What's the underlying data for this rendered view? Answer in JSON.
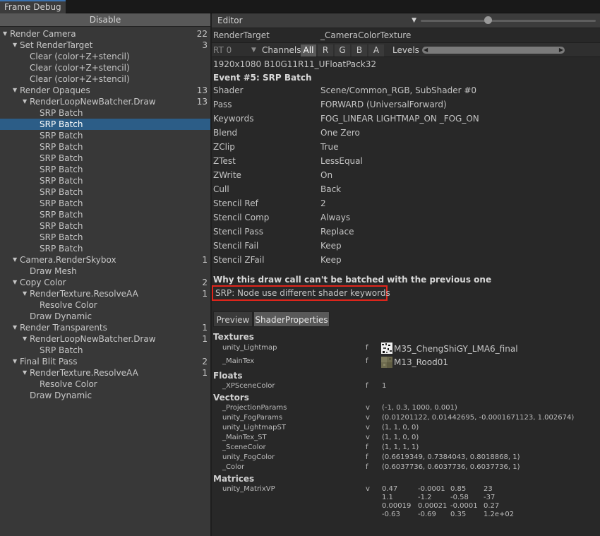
{
  "window": {
    "tab_title": "Frame Debug"
  },
  "left": {
    "disable_label": "Disable",
    "tree": [
      {
        "label": "Render Camera",
        "count": "22",
        "level": 0,
        "expanded": true
      },
      {
        "label": "Set RenderTarget",
        "count": "3",
        "level": 1,
        "expanded": true
      },
      {
        "label": "Clear (color+Z+stencil)",
        "count": "",
        "level": 2
      },
      {
        "label": "Clear (color+Z+stencil)",
        "count": "",
        "level": 2
      },
      {
        "label": "Clear (color+Z+stencil)",
        "count": "",
        "level": 2
      },
      {
        "label": "Render Opaques",
        "count": "13",
        "level": 1,
        "expanded": true
      },
      {
        "label": "RenderLoopNewBatcher.Draw",
        "count": "13",
        "level": 2,
        "expanded": true
      },
      {
        "label": "SRP Batch",
        "count": "",
        "level": 3
      },
      {
        "label": "SRP Batch",
        "count": "",
        "level": 3,
        "selected": true
      },
      {
        "label": "SRP Batch",
        "count": "",
        "level": 3
      },
      {
        "label": "SRP Batch",
        "count": "",
        "level": 3
      },
      {
        "label": "SRP Batch",
        "count": "",
        "level": 3
      },
      {
        "label": "SRP Batch",
        "count": "",
        "level": 3
      },
      {
        "label": "SRP Batch",
        "count": "",
        "level": 3
      },
      {
        "label": "SRP Batch",
        "count": "",
        "level": 3
      },
      {
        "label": "SRP Batch",
        "count": "",
        "level": 3
      },
      {
        "label": "SRP Batch",
        "count": "",
        "level": 3
      },
      {
        "label": "SRP Batch",
        "count": "",
        "level": 3
      },
      {
        "label": "SRP Batch",
        "count": "",
        "level": 3
      },
      {
        "label": "SRP Batch",
        "count": "",
        "level": 3
      },
      {
        "label": "Camera.RenderSkybox",
        "count": "1",
        "level": 1,
        "expanded": true
      },
      {
        "label": "Draw Mesh",
        "count": "",
        "level": 2
      },
      {
        "label": "Copy Color",
        "count": "2",
        "level": 1,
        "expanded": true
      },
      {
        "label": "RenderTexture.ResolveAA",
        "count": "1",
        "level": 2,
        "expanded": true
      },
      {
        "label": "Resolve Color",
        "count": "",
        "level": 3
      },
      {
        "label": "Draw Dynamic",
        "count": "",
        "level": 2
      },
      {
        "label": "Render Transparents",
        "count": "1",
        "level": 1,
        "expanded": true
      },
      {
        "label": "RenderLoopNewBatcher.Draw",
        "count": "1",
        "level": 2,
        "expanded": true
      },
      {
        "label": "SRP Batch",
        "count": "",
        "level": 3
      },
      {
        "label": "Final Blit Pass",
        "count": "2",
        "level": 1,
        "expanded": true
      },
      {
        "label": "RenderTexture.ResolveAA",
        "count": "1",
        "level": 2,
        "expanded": true
      },
      {
        "label": "Resolve Color",
        "count": "",
        "level": 3
      },
      {
        "label": "Draw Dynamic",
        "count": "",
        "level": 2
      }
    ]
  },
  "right": {
    "editor_dropdown": "Editor",
    "render_target_label": "RenderTarget",
    "render_target_value": "_CameraColorTexture",
    "rt_dropdown": "RT 0",
    "channels_label": "Channels",
    "channels": [
      "All",
      "R",
      "G",
      "B",
      "A"
    ],
    "levels_label": "Levels",
    "format": "1920x1080 B10G11R11_UFloatPack32",
    "event_title": "Event #5: SRP Batch",
    "state": [
      {
        "k": "Shader",
        "v": "Scene/Common_RGB, SubShader #0"
      },
      {
        "k": "Pass",
        "v": "FORWARD (UniversalForward)"
      },
      {
        "k": "Keywords",
        "v": "FOG_LINEAR LIGHTMAP_ON _FOG_ON"
      },
      {
        "k": "Blend",
        "v": "One Zero"
      },
      {
        "k": "ZClip",
        "v": "True"
      },
      {
        "k": "ZTest",
        "v": "LessEqual"
      },
      {
        "k": "ZWrite",
        "v": "On"
      },
      {
        "k": "Cull",
        "v": "Back"
      },
      {
        "k": "Stencil Ref",
        "v": "2"
      },
      {
        "k": "Stencil Comp",
        "v": "Always"
      },
      {
        "k": "Stencil Pass",
        "v": "Replace"
      },
      {
        "k": "Stencil Fail",
        "v": "Keep"
      },
      {
        "k": "Stencil ZFail",
        "v": "Keep"
      }
    ],
    "batch_reason_title": "Why this draw call can't be batched with the previous one",
    "batch_reason": "SRP: Node use different shader keywords",
    "tabs": [
      "Preview",
      "ShaderProperties"
    ],
    "textures_title": "Textures",
    "textures": [
      {
        "name": "unity_Lightmap",
        "type": "f",
        "value": "M35_ChengShiGY_LMA6_final"
      },
      {
        "name": "_MainTex",
        "type": "f",
        "value": "M13_Rood01"
      }
    ],
    "floats_title": "Floats",
    "floats": [
      {
        "name": "_XPSceneColor",
        "type": "f",
        "value": "1"
      }
    ],
    "vectors_title": "Vectors",
    "vectors": [
      {
        "name": "_ProjectionParams",
        "type": "v",
        "value": "(-1, 0.3, 1000, 0.001)"
      },
      {
        "name": "unity_FogParams",
        "type": "v",
        "value": "(0.01201122, 0.01442695, -0.0001671123, 1.002674)"
      },
      {
        "name": "unity_LightmapST",
        "type": "v",
        "value": "(1, 1, 0, 0)"
      },
      {
        "name": "_MainTex_ST",
        "type": "v",
        "value": "(1, 1, 0, 0)"
      },
      {
        "name": "_SceneColor",
        "type": "f",
        "value": "(1, 1, 1, 1)"
      },
      {
        "name": "unity_FogColor",
        "type": "f",
        "value": "(0.6619349, 0.7384043, 0.8018868, 1)"
      },
      {
        "name": "_Color",
        "type": "f",
        "value": "(0.6037736, 0.6037736, 0.6037736, 1)"
      }
    ],
    "matrices_title": "Matrices",
    "matrix": {
      "name": "unity_MatrixVP",
      "type": "v",
      "rows": [
        [
          "0.47",
          "-0.0001",
          "0.85",
          "23"
        ],
        [
          "1.1",
          "-1.2",
          "-0.58",
          "-37"
        ],
        [
          "0.00019",
          "0.00021",
          "-0.0001",
          "0.27"
        ],
        [
          "-0.63",
          "-0.69",
          "0.35",
          "1.2e+02"
        ]
      ]
    }
  },
  "colors": {
    "selection": "#2c5d87",
    "highlight_box": "#e0251b",
    "tab_accent": "#3a72b0"
  }
}
